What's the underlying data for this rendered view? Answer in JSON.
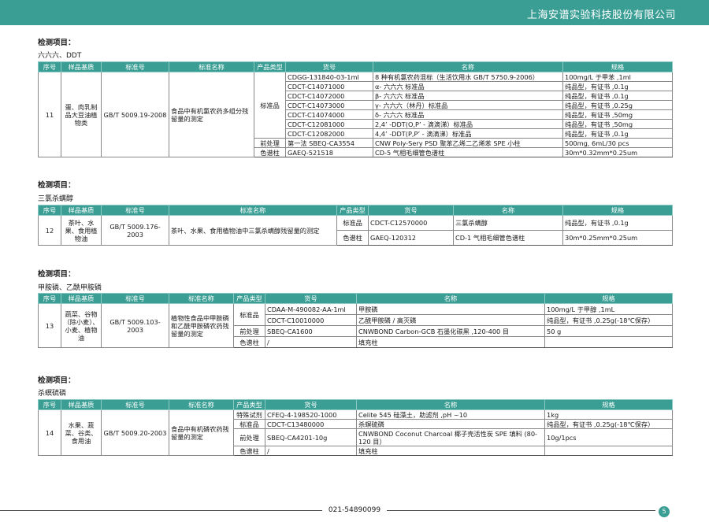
{
  "header": {
    "company": "上海安谱实验科技股份有限公司"
  },
  "footer": {
    "phone": "021-54890099",
    "page_number": "5"
  },
  "sections": [
    {
      "title": "检测项目：",
      "subtitle": "六六六、DDT",
      "headers": [
        "序号",
        "样品基质",
        "标准号",
        "标准名称",
        "产品类型",
        "货号",
        "名称",
        "规格"
      ],
      "no": "11",
      "matrix": "蛋、肉乳制品大豆油植物类",
      "standard_no": "GB/T 5009.19-2008",
      "standard_name": "食品中有机氯农药多组分残留量的测定",
      "rows": [
        {
          "type": "标准品",
          "code": "CDGG-131840-03-1ml",
          "name": "8 种有机氯农药混标（生活饮用水 GB/T 5750.9-2006）",
          "spec": "100mg/L 于甲苯 ,1ml"
        },
        {
          "type": "",
          "code": "CDCT-C14071000",
          "name": "α- 六六六 标准品",
          "spec": "纯品型，有证书 ,0.1g"
        },
        {
          "type": "",
          "code": "CDCT-C14072000",
          "name": "β- 六六六 标准品",
          "spec": "纯品型，有证书 ,0.1g"
        },
        {
          "type": "",
          "code": "CDCT-C14073000",
          "name": "γ- 六六六（林丹）标准品",
          "spec": "纯品型，有证书 ,0.25g"
        },
        {
          "type": "",
          "code": "CDCT-C14074000",
          "name": "δ- 六六六 标准品",
          "spec": "纯品型，有证书 ,50mg"
        },
        {
          "type": "",
          "code": "CDCT-C12081000",
          "name": "2,4’ -DDT(O,P’ - 滴滴涕）标准品",
          "spec": "纯品型，有证书 ,50mg"
        },
        {
          "type": "",
          "code": "CDCT-C12082000",
          "name": "4,4’ -DDT(P,P’ - 滴滴涕）标准品",
          "spec": "纯品型，有证书 ,0.1g"
        },
        {
          "type": "前处理",
          "code": "第一法 SBEQ-CA3554",
          "name": "CNW Poly-Sery PSD 聚苯乙烯二乙烯苯 SPE 小柱",
          "spec": "500mg, 6mL/30 pcs"
        },
        {
          "type": "色谱柱",
          "code": "GAEQ-521518",
          "name": "CD-5 气相毛细管色谱柱",
          "spec": "30m*0.32mm*0.25um"
        }
      ]
    },
    {
      "title": "检测项目：",
      "subtitle": "三氯杀螨醇",
      "headers": [
        "序号",
        "样品基质",
        "标准号",
        "标准名称",
        "产品类型",
        "货号",
        "名称",
        "规格"
      ],
      "no": "12",
      "matrix": "茶叶、水果、食用植物油",
      "standard_no": "GB/T 5009.176-2003",
      "standard_name": "茶叶、水果、食用植物油中三氯杀螨醇残留量的测定",
      "rows": [
        {
          "type": "标准品",
          "code": "CDCT-C12570000",
          "name": "三氯杀螨醇",
          "spec": "纯品型，有证书 ,0.1g"
        },
        {
          "type": "色谱柱",
          "code": "GAEQ-120312",
          "name": "CD-1 气相毛细管色谱柱",
          "spec": "30m*0.25mm*0.25um"
        }
      ]
    },
    {
      "title": "检测项目：",
      "subtitle": "甲胺磷、乙酰甲胺磷",
      "headers": [
        "序号",
        "样品基质",
        "标准号",
        "标准名称",
        "产品类型",
        "货号",
        "名称",
        "规格"
      ],
      "no": "13",
      "matrix": "蔬菜、谷物（除小麦）、小麦、植物油",
      "standard_no": "GB/T 5009.103-2003",
      "standard_name": "植物性食品中甲胺磷和乙酰甲胺磷农药残留量的测定",
      "rows": [
        {
          "type": "标准品",
          "code": "CDAA-M-490082-AA-1ml",
          "name": "甲胺磷",
          "spec": "100mg/L 于甲醇 ,1mL"
        },
        {
          "type": "",
          "code": "CDCT-C10010000",
          "name": "乙酰甲胺磷 / 高灭磷",
          "spec": "纯品型，有证书 ,0.25g(-18℃保存）"
        },
        {
          "type": "前处理",
          "code": "SBEQ-CA1600",
          "name": "CNWBOND Carbon-GCB 石墨化碳黑 ,120-400 目",
          "spec": "50 g"
        },
        {
          "type": "色谱柱",
          "code": "/",
          "name": "填充柱",
          "spec": ""
        }
      ]
    },
    {
      "title": "检测项目：",
      "subtitle": "杀螟硫磷",
      "headers": [
        "序号",
        "样品基质",
        "标准号",
        "标准名称",
        "产品类型",
        "货号",
        "名称",
        "规格"
      ],
      "no": "14",
      "matrix": "水果、蔬菜、谷类、食用油",
      "standard_no": "GB/T 5009.20-2003",
      "standard_name": "食品中有机磷农药残留量的测定",
      "rows": [
        {
          "type": "特殊试剂",
          "code": "CFEQ-4-198520-1000",
          "name": "Celite 545 硅藻土，助滤剂 ,pH ~10",
          "spec": "1kg"
        },
        {
          "type": "标准品",
          "code": "CDCT-C13480000",
          "name": "杀螟硫磷",
          "spec": "纯品型，有证书 ,0.25g(-18℃保存）"
        },
        {
          "type": "前处理",
          "code": "SBEQ-CA4201-10g",
          "name": "CNWBOND Coconut Charcoal 椰子壳活性炭 SPE 填料 (80-120 目）",
          "spec": "10g/1pcs"
        },
        {
          "type": "色谱柱",
          "code": "/",
          "name": "填充柱",
          "spec": ""
        }
      ]
    }
  ]
}
